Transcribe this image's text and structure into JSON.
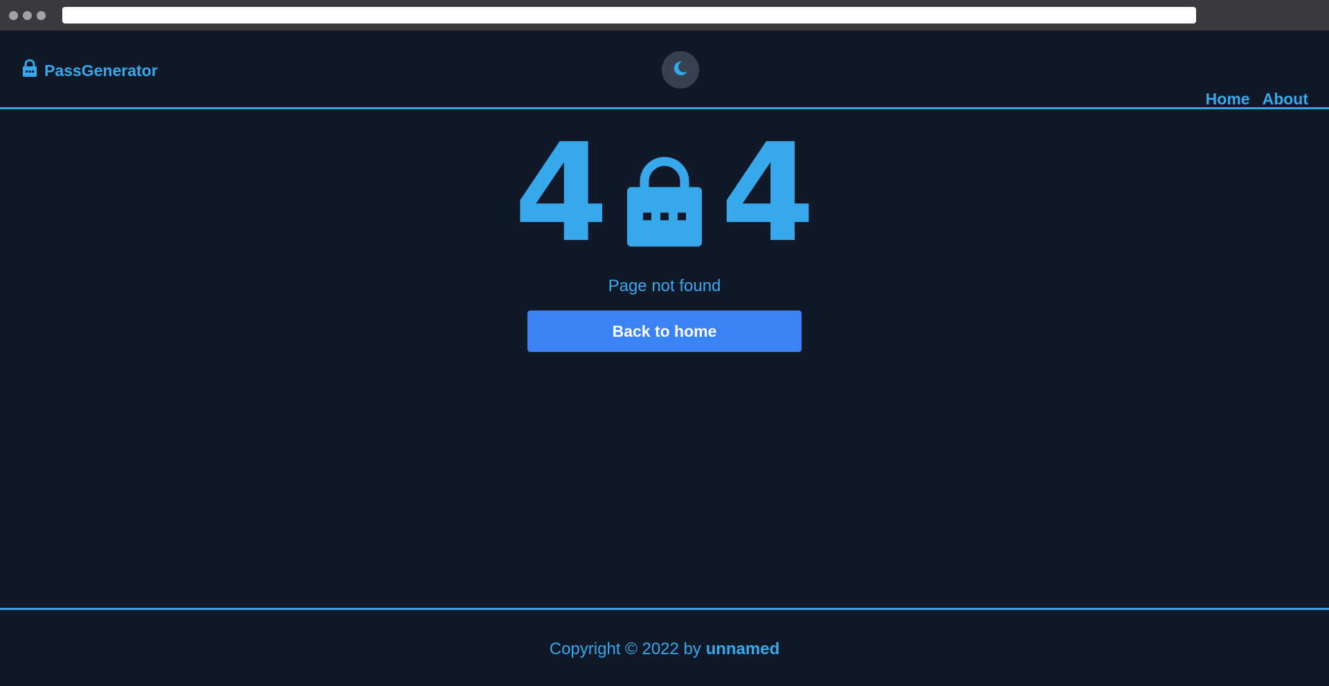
{
  "app": {
    "brand": "PassGenerator",
    "accent_color": "#38a8ec",
    "background_color": "#111827"
  },
  "navbar": {
    "theme_toggle_icon": "moon-icon",
    "links": [
      {
        "label": "Home"
      },
      {
        "label": "About"
      }
    ]
  },
  "error": {
    "digit_left": "4",
    "digit_right": "4",
    "center_icon": "lock-icon",
    "message": "Page not found",
    "button_label": "Back to home",
    "button_color": "#3b82f6"
  },
  "footer": {
    "copyright_prefix": "Copyright © 2022 by",
    "author": "unnamed"
  }
}
